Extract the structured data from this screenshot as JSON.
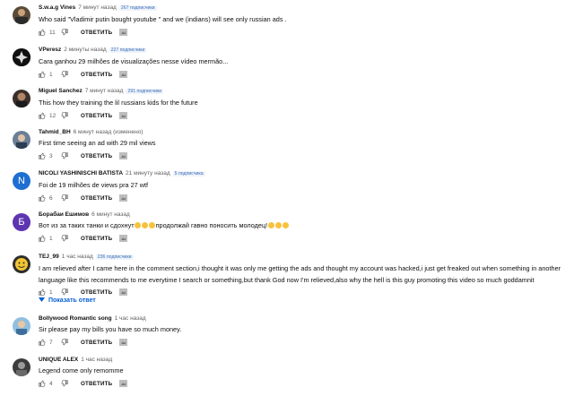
{
  "reply_label": "ОТВЕТИТЬ",
  "comments": [
    {
      "author": "S.w.a.g Vines",
      "time": "7 минут назад",
      "subs": "267 подписчики",
      "text": "Who said \"Vladimir putin bought youtube \" and we (indians) will see only russian ads .",
      "likes": "11",
      "avatar": "photo"
    },
    {
      "author": "VPeresz",
      "time": "2 минуты назад",
      "subs": "227 подписчики",
      "text": "Cara ganhou 29 milhões de visualizações nesse vídeo mermão...",
      "likes": "1",
      "avatar": "logo"
    },
    {
      "author": "Miguel Sanchez",
      "time": "7 минут назад",
      "subs": "291 подписчики",
      "text": "This how they training the lil russians kids for the future",
      "likes": "12",
      "avatar": "photo"
    },
    {
      "author": "Tahmid_BH",
      "time": "6 минут назад (изменено)",
      "subs": "",
      "text": "First time seeing an ad with 29 mil views",
      "likes": "3",
      "avatar": "photo"
    },
    {
      "author": "NICOLI YASHINISCHI BATISTA",
      "time": "21 минуту назад",
      "subs": "5 подписчика",
      "text": "Foi de 19 milhões de views pra 27 wtf",
      "likes": "6",
      "avatar": "letter",
      "letter": "N",
      "color": "#1e6fd1"
    },
    {
      "author": "Борабаи Ешимов",
      "time": "6 минут назад",
      "subs": "",
      "text_parts": [
        "Вот из за таких танки и сдохнут",
        "продолжай гавно поносить молодец!"
      ],
      "likes": "1",
      "avatar": "letter",
      "letter": "Б",
      "color": "#5e35b1"
    },
    {
      "author": "TEJ_99",
      "time": "1 час назад",
      "subs": "236 подписчики",
      "text": "I am relieved after I came here in the comment section,i thought it was only me getting the ads and thought my account was hacked,i just get freaked out when something in another language like this recommends to me everytime I search or something,but thank God now I'm relieved,also why the hell is this guy promoting this video so much goddamnit",
      "likes": "1",
      "avatar": "photo"
    },
    {
      "author": "Bollywood Romantic song",
      "time": "1 час назад",
      "subs": "",
      "text": "Sir please pay my bills you have so much money.",
      "likes": "7",
      "avatar": "photo"
    },
    {
      "author": "UNIQUE ALEX",
      "time": "1 час назад",
      "subs": "",
      "text": "Legend come only remomme",
      "likes": "4",
      "avatar": "photo"
    }
  ],
  "show_replies": "Показать ответ"
}
